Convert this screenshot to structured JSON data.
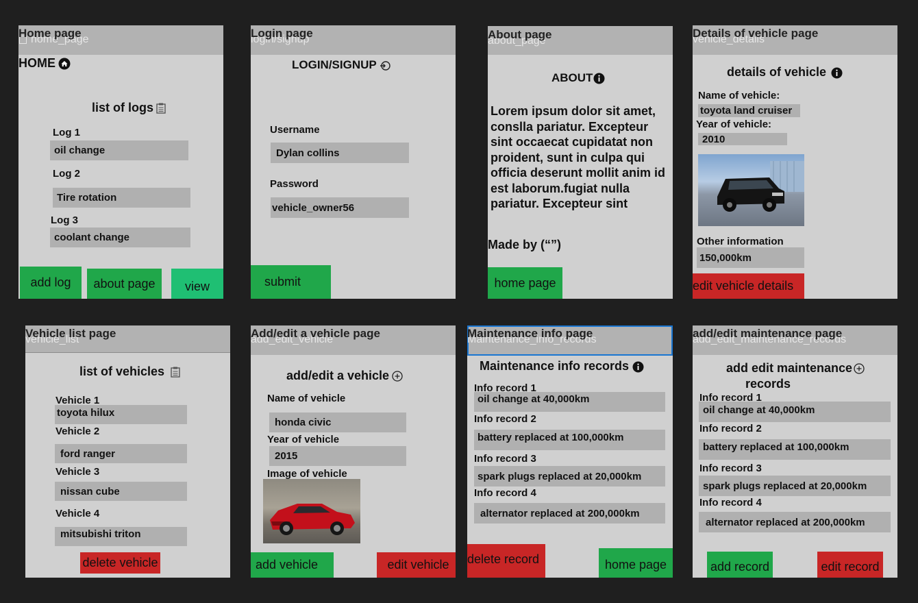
{
  "home": {
    "title": "Home page",
    "sub": "home_page",
    "heading": "HOME",
    "list_title": "list of logs",
    "logs": [
      {
        "label": "Log 1",
        "value": "oil change"
      },
      {
        "label": "Log 2",
        "value": "Tire rotation"
      },
      {
        "label": "Log 3",
        "value": "coolant change"
      }
    ],
    "btn_add": "add log",
    "btn_about": "about page",
    "btn_view": "view"
  },
  "login": {
    "title": "Login page",
    "sub": "login/signup",
    "heading": "LOGIN/SIGNUP",
    "username_label": "Username",
    "username_value": "Dylan collins",
    "password_label": "Password",
    "password_value": "vehicle_owner56",
    "btn_submit": "submit"
  },
  "about": {
    "title": "About page",
    "sub": "about_page",
    "heading": "ABOUT",
    "text": "Lorem ipsum dolor sit amet, conslla pariatur. Excepteur sint occaecat cupidatat non proident, sunt in culpa qui officia deserunt mollit anim id est laborum.fugiat nulla pariatur. Excepteur sint",
    "made_by": "Made by (“”)",
    "btn_home": "home page"
  },
  "details": {
    "title": "Details of vehicle page",
    "sub": "vehicle_details",
    "heading": "details of vehicle",
    "name_label": "Name of vehicle:",
    "name_value": "toyota land cruiser",
    "year_label": "Year of vehicle:",
    "year_value": "2010",
    "other_label": "Other information",
    "other_value": "150,000km",
    "btn_edit": "edit vehicle details"
  },
  "vlist": {
    "title": "Vehicle list page",
    "sub": "vehicle_list",
    "heading": "list of vehicles",
    "vehicles": [
      {
        "label": "Vehicle 1",
        "value": "toyota hilux"
      },
      {
        "label": "Vehicle 2",
        "value": "ford ranger"
      },
      {
        "label": "Vehicle 3",
        "value": "nissan cube"
      },
      {
        "label": "Vehicle 4",
        "value": "mitsubishi triton"
      }
    ],
    "btn_delete": "delete vehicle"
  },
  "addedit": {
    "title": "Add/edit a vehicle page",
    "sub": "add_edit_vehicle",
    "heading": "add/edit a vehicle",
    "name_label": "Name of vehicle",
    "name_value": "honda civic",
    "year_label": "Year of vehicle",
    "year_value": "2015",
    "image_label": "Image of vehicle",
    "btn_add": "add vehicle",
    "btn_edit": "edit vehicle"
  },
  "maint": {
    "title": "Maintenance info page",
    "sub": "Maintenance_info_records",
    "heading": "Maintenance info records",
    "records": [
      {
        "label": "Info record 1",
        "value": "oil change at 40,000km"
      },
      {
        "label": "Info record 2",
        "value": "battery replaced at 100,000km"
      },
      {
        "label": "Info record 3",
        "value": "spark plugs replaced at 20,000km"
      },
      {
        "label": "Info record 4",
        "value": "alternator replaced at 200,000km"
      }
    ],
    "btn_delete": "delete record",
    "btn_home": "home page"
  },
  "maintedit": {
    "title": "add/edit maintenance page",
    "sub": "add_edit_maintenance_records",
    "heading_1": "add edit maintenance",
    "heading_2": "records",
    "records": [
      {
        "label": "Info record 1",
        "value": "oil change at 40,000km"
      },
      {
        "label": "Info record 2",
        "value": "battery replaced at 100,000km"
      },
      {
        "label": "Info record 3",
        "value": "spark plugs replaced at 20,000km"
      },
      {
        "label": "Info record 4",
        "value": "alternator replaced at 200,000km"
      }
    ],
    "btn_add": "add record",
    "btn_edit": "edit record"
  },
  "colors": {
    "background": "#1f1f1f",
    "frame": "#d0d0d0",
    "header": "#b2b2b2",
    "field": "#b0b0b0",
    "green": "#20a74a",
    "teal": "#1fbf73",
    "red": "#c82626",
    "selection": "#1976d2"
  }
}
